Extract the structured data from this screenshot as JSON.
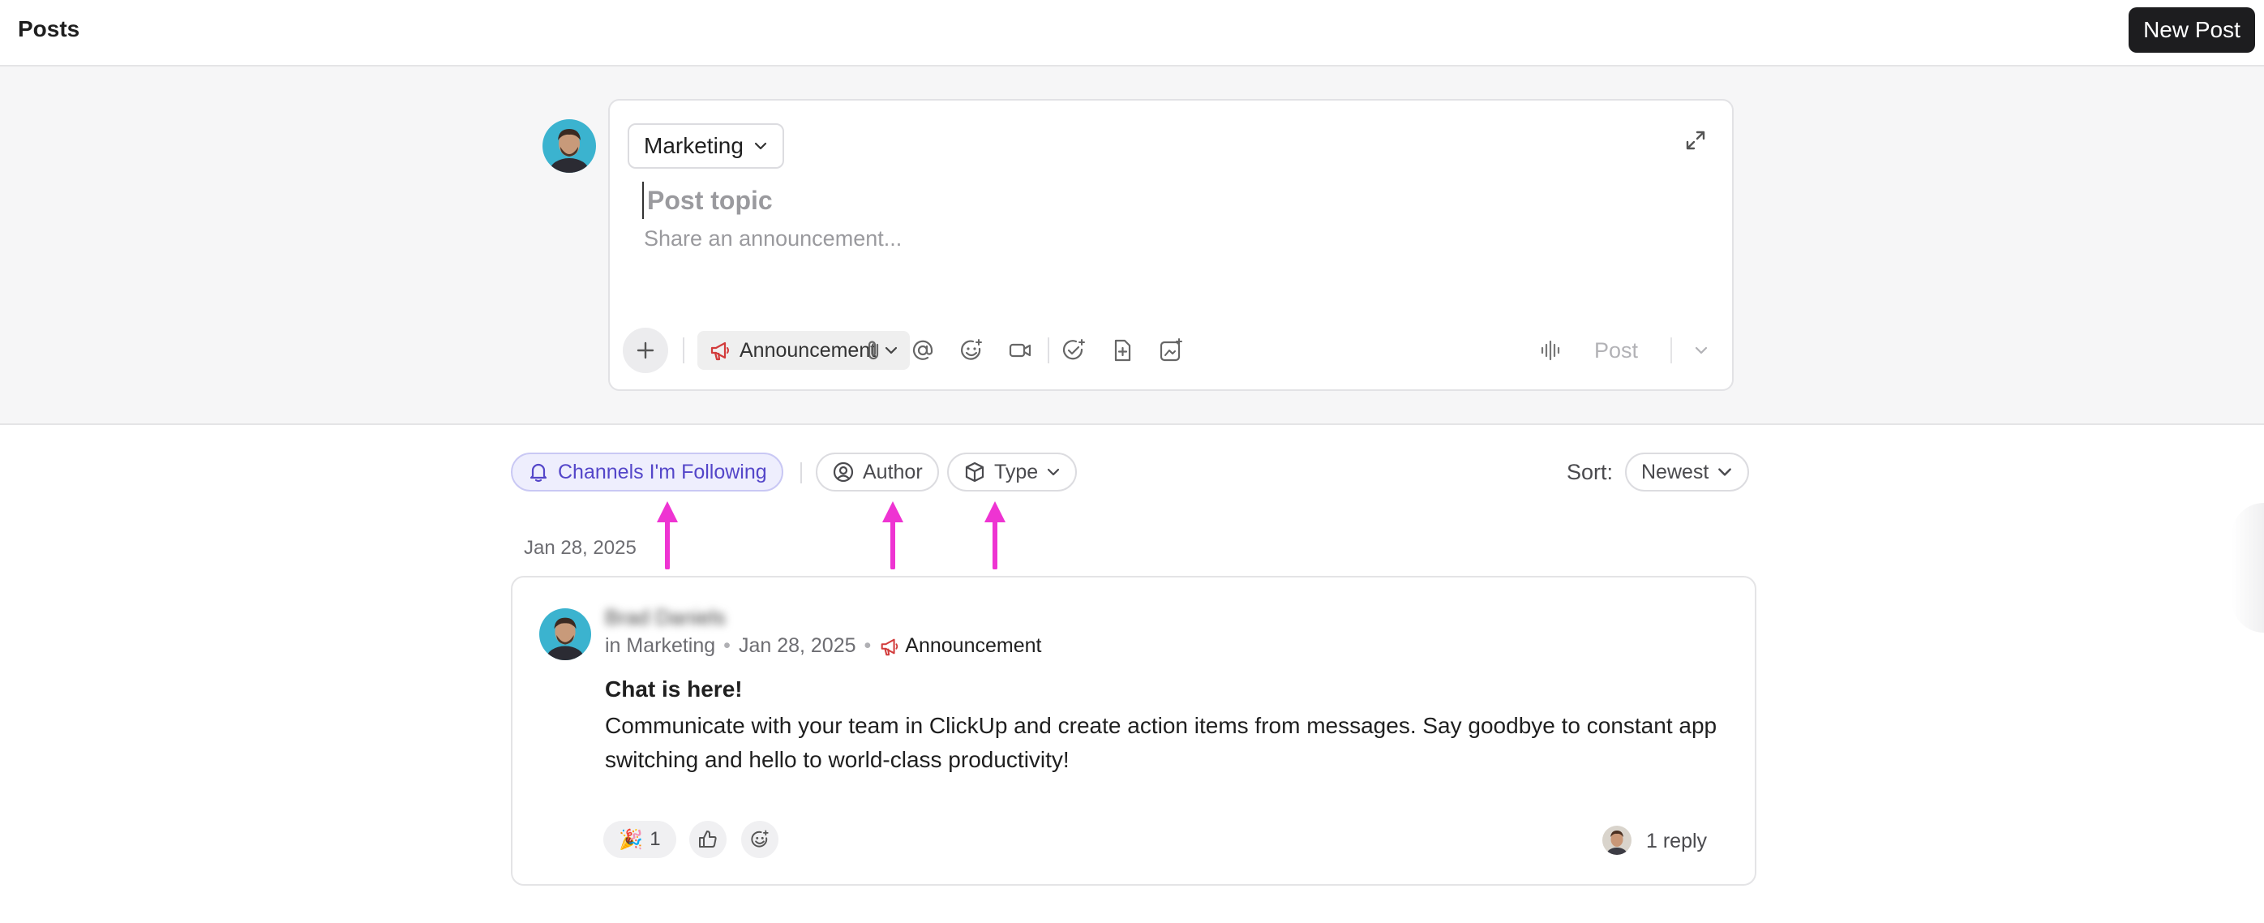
{
  "header": {
    "title": "Posts",
    "new_post_label": "New Post"
  },
  "composer": {
    "channel": "Marketing",
    "topic_placeholder": "Post topic",
    "body_placeholder": "Share an announcement...",
    "post_type": "Announcement",
    "post_label": "Post"
  },
  "filters": {
    "following_label": "Channels I'm Following",
    "author_label": "Author",
    "type_label": "Type",
    "sort_label": "Sort:",
    "sort_value": "Newest"
  },
  "feed": {
    "date_header": "Jan 28, 2025",
    "posts": [
      {
        "author": "Brad Daniels",
        "channel": "in Marketing",
        "date": "Jan 28, 2025",
        "type": "Announcement",
        "title": "Chat is here!",
        "body": "Communicate with your team in ClickUp and create action items from messages. Say goodbye to constant app switching and hello to world-class productivity!",
        "reactions": [
          {
            "emoji": "🎉",
            "count": "1"
          }
        ],
        "replies": "1 reply"
      }
    ]
  },
  "colors": {
    "accent": "#5446c9",
    "announcement": "#d23b3b",
    "annotation_arrow": "#ee34d2"
  }
}
